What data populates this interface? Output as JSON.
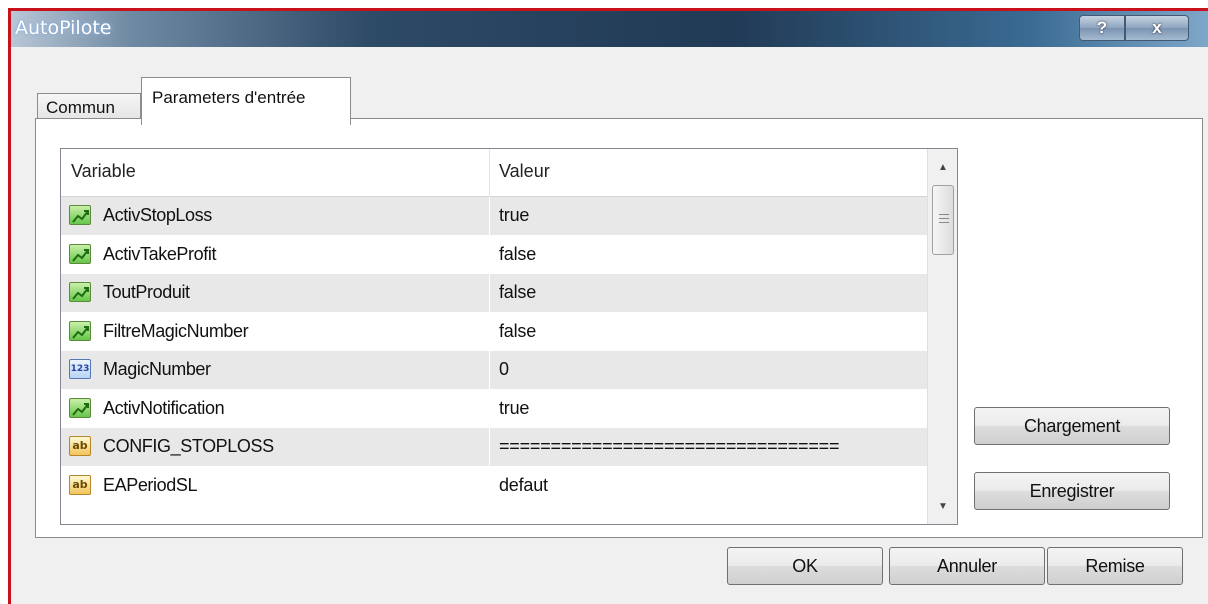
{
  "window": {
    "title": "AutoPilote",
    "help_label": "?",
    "close_label": "x"
  },
  "tabs": [
    {
      "label": "Commun"
    },
    {
      "label": "Parameters d'entrée"
    }
  ],
  "grid": {
    "columns": {
      "variable": "Variable",
      "value": "Valeur"
    },
    "rows": [
      {
        "type": "bool",
        "icon": "bool-icon",
        "name": "ActivStopLoss",
        "value": "true"
      },
      {
        "type": "bool",
        "icon": "bool-icon",
        "name": "ActivTakeProfit",
        "value": "false"
      },
      {
        "type": "bool",
        "icon": "bool-icon",
        "name": "ToutProduit",
        "value": "false"
      },
      {
        "type": "bool",
        "icon": "bool-icon",
        "name": "FiltreMagicNumber",
        "value": "false"
      },
      {
        "type": "num",
        "icon": "integer-icon",
        "glyph": "123",
        "name": "MagicNumber",
        "value": "0"
      },
      {
        "type": "bool",
        "icon": "bool-icon",
        "name": "ActivNotification",
        "value": "true"
      },
      {
        "type": "str",
        "icon": "string-icon",
        "glyph": "ab",
        "name": "CONFIG_STOPLOSS",
        "value": "================================="
      },
      {
        "type": "str",
        "icon": "string-icon",
        "glyph": "ab",
        "name": "EAPeriodSL",
        "value": "defaut"
      }
    ]
  },
  "side_buttons": {
    "load": "Chargement",
    "save": "Enregistrer"
  },
  "footer_buttons": {
    "ok": "OK",
    "cancel": "Annuler",
    "reset": "Remise"
  }
}
